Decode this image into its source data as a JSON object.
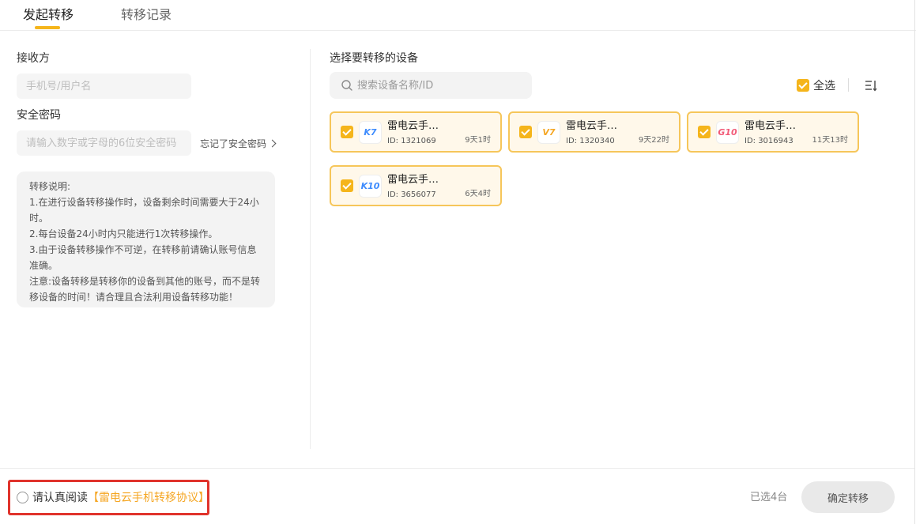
{
  "tabs": [
    {
      "label": "发起转移",
      "active": true
    },
    {
      "label": "转移记录",
      "active": false
    }
  ],
  "colors": {
    "accent": "#f5b51b",
    "card_border": "#f6c65a",
    "card_bg": "#fff8ea",
    "link": "#f5a623",
    "highlight_box": "#e0332c"
  },
  "receiver": {
    "label": "接收方",
    "placeholder": "手机号/用户名",
    "value": ""
  },
  "password": {
    "label": "安全密码",
    "placeholder": "请输入数字或字母的6位安全密码",
    "value": "",
    "forgot_label": "忘记了安全密码"
  },
  "notice": {
    "lines": [
      "转移说明:",
      "1.在进行设备转移操作时，设备剩余时间需要大于24小时。",
      "2.每台设备24小时内只能进行1次转移操作。",
      "3.由于设备转移操作不可逆，在转移前请确认账号信息准确。",
      "注意:设备转移是转移你的设备到其他的账号，而不是转移设备的时间！请合理且合法利用设备转移功能！"
    ]
  },
  "devices_section": {
    "title": "选择要转移的设备",
    "search_placeholder": "搜索设备名称/ID",
    "search_icon": "search-icon",
    "select_all_label": "全选",
    "select_all_checked": true,
    "sort_icon": "sort-icon"
  },
  "devices": [
    {
      "name": "雷电云手…",
      "id": "ID: 1321069",
      "time": "9天1时",
      "badge": "K7",
      "badge_color": "#3d8bfd",
      "checked": true
    },
    {
      "name": "雷电云手…",
      "id": "ID: 1320340",
      "time": "9天22时",
      "badge": "V7",
      "badge_color": "#f5a623",
      "checked": true
    },
    {
      "name": "雷电云手…",
      "id": "ID: 3016943",
      "time": "11天13时",
      "badge": "G10",
      "badge_color": "#f25b78",
      "checked": true
    },
    {
      "name": "雷电云手…",
      "id": "ID: 3656077",
      "time": "6天4时",
      "badge": "K10",
      "badge_color": "#3d8bfd",
      "checked": true
    }
  ],
  "footer": {
    "agree_prefix": "请认真阅读",
    "agree_link": "【雷电云手机转移协议】",
    "agree_checked": false,
    "selected_count": "已选4台",
    "confirm_label": "确定转移"
  }
}
